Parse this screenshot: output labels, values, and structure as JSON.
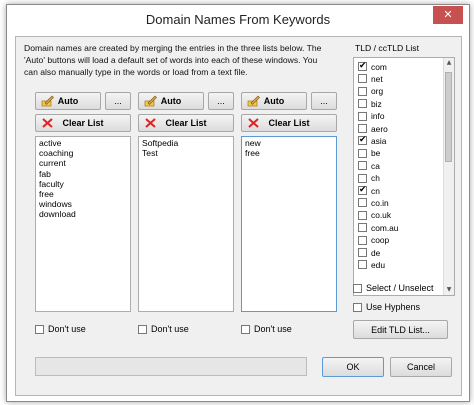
{
  "window": {
    "title": "Domain Names From Keywords",
    "close_glyph": "✕"
  },
  "description": "Domain names are created by merging the entries in the three lists below. The 'Auto' buttons will load a default set of words into each of these windows. You can also manually type in the words or load from a text file.",
  "buttons": {
    "auto": "Auto",
    "more": "...",
    "clear": "Clear List"
  },
  "lists": [
    {
      "words": "active\ncoaching\ncurrent\nfab\nfaculty\nfree\nwindows\ndownload",
      "dont_use": "Don't use"
    },
    {
      "words": "Softpedia\nTest",
      "dont_use": "Don't use"
    },
    {
      "words": "new\nfree",
      "dont_use": "Don't use"
    }
  ],
  "tld": {
    "label": "TLD / ccTLD List",
    "items": [
      {
        "name": "com",
        "checked": true
      },
      {
        "name": "net",
        "checked": false
      },
      {
        "name": "org",
        "checked": false
      },
      {
        "name": "biz",
        "checked": false
      },
      {
        "name": "info",
        "checked": false
      },
      {
        "name": "aero",
        "checked": false
      },
      {
        "name": "asia",
        "checked": true
      },
      {
        "name": "be",
        "checked": false
      },
      {
        "name": "ca",
        "checked": false
      },
      {
        "name": "ch",
        "checked": false
      },
      {
        "name": "cn",
        "checked": true
      },
      {
        "name": "co.in",
        "checked": false
      },
      {
        "name": "co.uk",
        "checked": false
      },
      {
        "name": "com.au",
        "checked": false
      },
      {
        "name": "coop",
        "checked": false
      },
      {
        "name": "de",
        "checked": false
      },
      {
        "name": "edu",
        "checked": false
      }
    ],
    "select_unselect": "Select / Unselect",
    "use_hyphens": "Use Hyphens",
    "edit_button": "Edit TLD List..."
  },
  "footer": {
    "ok": "OK",
    "cancel": "Cancel"
  },
  "icon_names": {
    "auto": "pencil-icon",
    "clear": "red-x-icon",
    "close": "close-icon"
  },
  "colors": {
    "focus_border": "#5b9bd5",
    "close_red": "#c75050"
  }
}
